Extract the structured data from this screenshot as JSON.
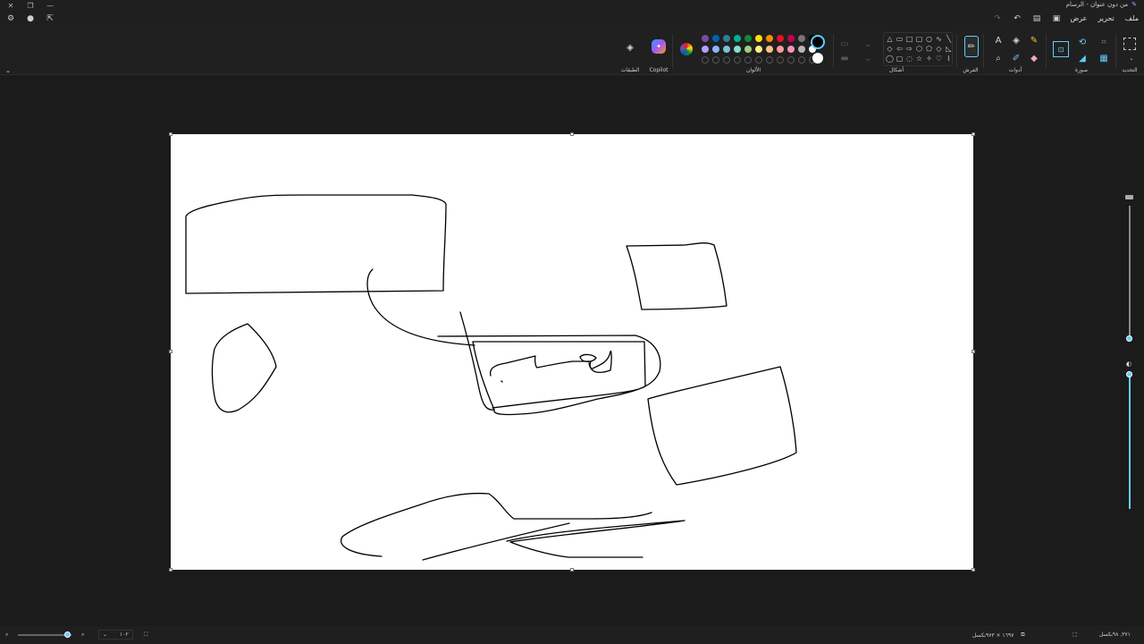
{
  "titlebar": {
    "title": "من دون عنوان - الرسام"
  },
  "menu": {
    "file": "ملف",
    "edit": "تحرير",
    "view": "عرض"
  },
  "ribbon": {
    "selection_label": "التحديد",
    "image_label": "صورة",
    "tools_label": "أدوات",
    "brushes_label": "الفرش",
    "shapes_label": "أشكال",
    "colors_label": "الألوان",
    "copilot_label": "Copilot",
    "layers_label": "الطبقات"
  },
  "colors": {
    "row1": [
      "#744da9",
      "#0063b1",
      "#2d7d9a",
      "#00b294",
      "#10893e",
      "#fce100",
      "#ff8c00",
      "#e81123",
      "#c30052",
      "#7a7574",
      "#000000"
    ],
    "row2": [
      "#b4a0ff",
      "#8cb4ff",
      "#79c4d8",
      "#82e0c8",
      "#9ed07e",
      "#fff27a",
      "#ffc283",
      "#ff9999",
      "#ff8fbf",
      "#b9b4b0",
      "#ffffff"
    ],
    "primary": "#000000",
    "secondary": "#ffffff"
  },
  "status": {
    "cursor_pos": "٣٧١, ٩٨بكسل",
    "canvas_size": "١٦٩٧ × ٩٧٣بكسل",
    "zoom": "١٠٢",
    "zoom_level": 0.5
  }
}
